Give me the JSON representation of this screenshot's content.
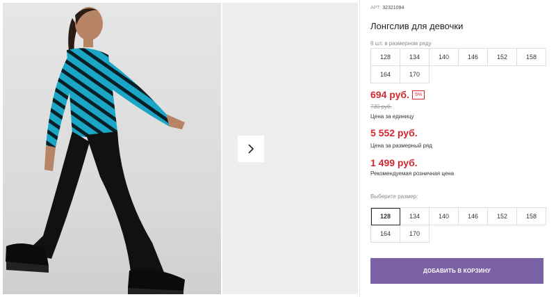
{
  "product": {
    "article_label": "АРТ:",
    "article_number": "32321094",
    "title": "Лонгслив для девочки",
    "pack_label": "8 шт. в размерном ряду",
    "pack_sizes": [
      "128",
      "134",
      "140",
      "146",
      "152",
      "158",
      "164",
      "170"
    ]
  },
  "pricing": {
    "unit_price": "694 руб.",
    "discount": "5%",
    "old_price": "730 руб.",
    "unit_caption": "Цена за единицу",
    "row_price": "5 552 руб.",
    "row_caption": "Цена за размерный ряд",
    "rrp_price": "1 499 руб.",
    "rrp_caption": "Рекомендуемая розничная цена"
  },
  "size_select": {
    "label": "Выберите размер:",
    "sizes": [
      "128",
      "134",
      "140",
      "146",
      "152",
      "158",
      "164",
      "170"
    ],
    "selected": "128"
  },
  "actions": {
    "add_to_cart": "ДОБАВИТЬ В КОРЗИНУ"
  },
  "colors": {
    "price_red": "#d4262f",
    "button_purple": "#7a62a4",
    "top_turquoise": "#1aa6c4",
    "pants_black": "#111111"
  },
  "gallery": {
    "next_icon": "chevron-right-icon"
  }
}
